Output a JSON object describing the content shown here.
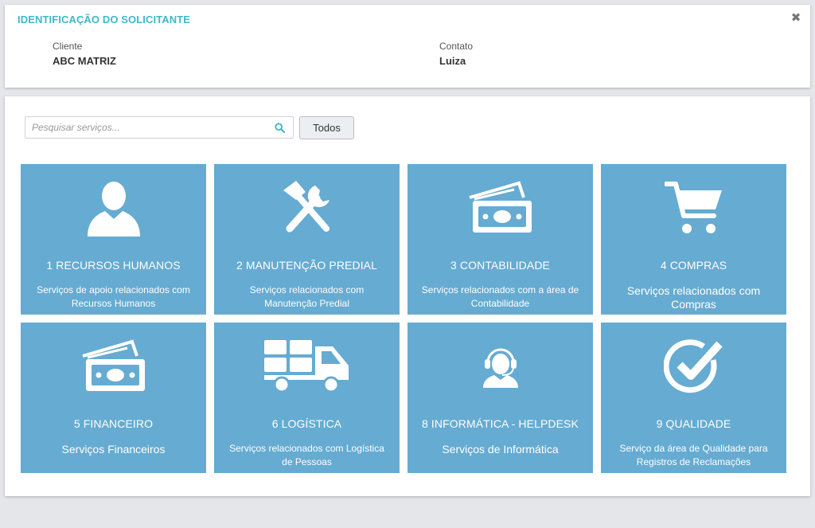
{
  "header": {
    "title": "IDENTIFICAÇÃO DO SOLICITANTE",
    "close_glyph": "✖",
    "client_label": "Cliente",
    "client_value": "ABC MATRIZ",
    "contact_label": "Contato",
    "contact_value": "Luiza"
  },
  "search": {
    "placeholder": "Pesquisar serviços...",
    "value": "",
    "button_label": "Todos"
  },
  "colors": {
    "tile": "#66abd1",
    "accent": "#3fb8c8"
  },
  "services": [
    {
      "icon": "user-icon",
      "title": "1 RECURSOS HUMANOS",
      "desc": "Serviços de apoio relacionados com Recursos Humanos"
    },
    {
      "icon": "tools-icon",
      "title": "2 MANUTENÇÃO PREDIAL",
      "desc": "Serviços relacionados com Manutenção Predial"
    },
    {
      "icon": "money-icon",
      "title": "3 CONTABILIDADE",
      "desc": "Serviços relacionados com a área de Contabilidade"
    },
    {
      "icon": "cart-icon",
      "title": "4 COMPRAS",
      "desc": "Serviços relacionados com Compras"
    },
    {
      "icon": "money-icon",
      "title": "5 FINANCEIRO",
      "desc": "Serviços Financeiros"
    },
    {
      "icon": "truck-icon",
      "title": "6 LOGÍSTICA",
      "desc": "Serviços relacionados com Logística de Pessoas"
    },
    {
      "icon": "headset-icon",
      "title": "8 INFORMÁTICA - HELPDESK",
      "desc": "Serviços de Informática"
    },
    {
      "icon": "check-circle-icon",
      "title": "9 QUALIDADE",
      "desc": "Serviço da área de Qualidade para Registros de Reclamações"
    }
  ]
}
